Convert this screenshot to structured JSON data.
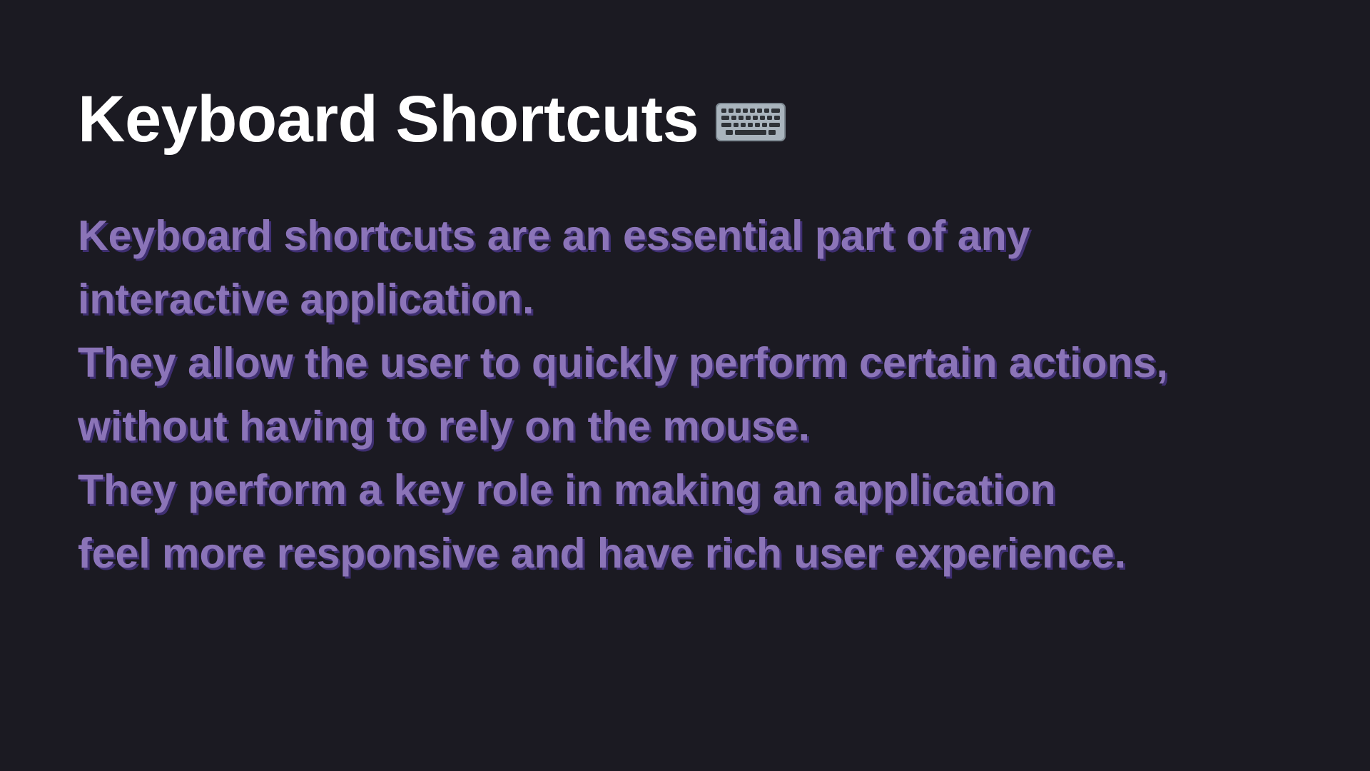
{
  "slide": {
    "title": "Keyboard Shortcuts",
    "title_icon": "keyboard-icon",
    "lines": [
      "Keyboard shortcuts are an essential part of any",
      "interactive application.",
      "They allow the user to quickly perform certain actions,",
      "without having to rely on the mouse.",
      "They perform a key role in making an application",
      "feel more responsive and have rich user experience."
    ]
  },
  "colors": {
    "background": "#1b1a22",
    "title": "#ffffff",
    "body_text": "#8b74b8",
    "body_shadow": "#3f2f72"
  }
}
